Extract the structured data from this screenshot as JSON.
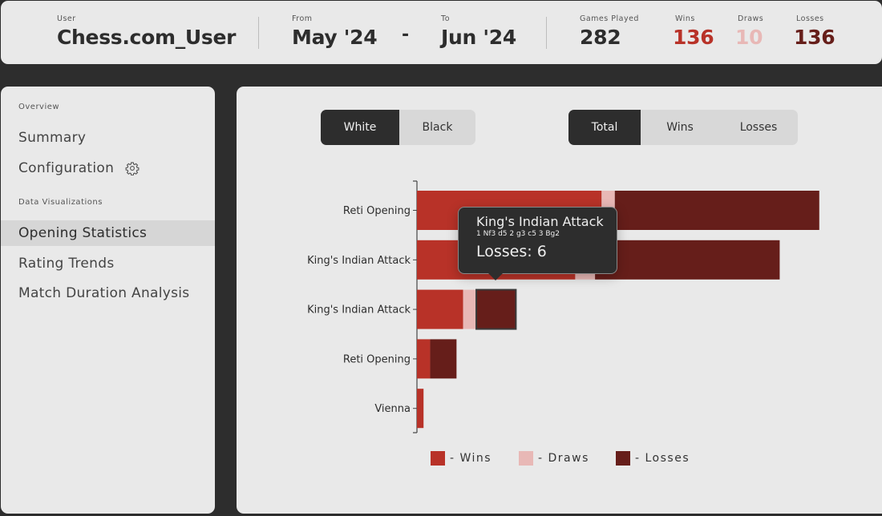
{
  "header": {
    "user_label": "User",
    "user_value": "Chess.com_User",
    "from_label": "From",
    "from_value": "May '24",
    "range_separator": "-",
    "to_label": "To",
    "to_value": "Jun '24",
    "games_label": "Games Played",
    "games_value": "282",
    "wins_label": "Wins",
    "wins_value": "136",
    "draws_label": "Draws",
    "draws_value": "10",
    "losses_label": "Losses",
    "losses_value": "136"
  },
  "colors": {
    "wins": "#b83228",
    "draws": "#e8b8b6",
    "losses": "#661e1a",
    "dark": "#2d2d2d",
    "panel": "#e9e9e9"
  },
  "sidebar": {
    "section_overview": "Overview",
    "items_overview": [
      {
        "label": "Summary"
      },
      {
        "label": "Configuration",
        "icon": "gear-icon"
      }
    ],
    "section_viz": "Data Visualizations",
    "items_viz": [
      {
        "label": "Opening Statistics",
        "active": true
      },
      {
        "label": "Rating Trends"
      },
      {
        "label": "Match Duration Analysis"
      }
    ]
  },
  "toggles": {
    "color": [
      "White",
      "Black"
    ],
    "color_selected": "White",
    "metric": [
      "Total",
      "Wins",
      "Losses"
    ],
    "metric_selected": "Total"
  },
  "tooltip": {
    "title": "King's Indian Attack",
    "moves": "1 Nf3 d5 2 g3 c5 3 Bg2",
    "value": "Losses: 6"
  },
  "chart_data": {
    "type": "bar",
    "orientation": "horizontal",
    "stacked": true,
    "categories": [
      "Reti Opening",
      "King's Indian Attack",
      "King's Indian Attack",
      "Reti Opening",
      "Vienna"
    ],
    "series": [
      {
        "name": "Wins",
        "values": [
          28,
          24,
          7,
          2,
          1
        ]
      },
      {
        "name": "Draws",
        "values": [
          2,
          3,
          2,
          0,
          0
        ]
      },
      {
        "name": "Losses",
        "values": [
          31,
          28,
          6,
          4,
          0
        ]
      }
    ],
    "xlim": [
      0,
      62
    ],
    "highlighted": {
      "category_index": 2,
      "series": "Losses"
    },
    "legend": [
      "- Wins",
      "- Draws",
      "- Losses"
    ],
    "legend_position": "bottom",
    "grid": false
  }
}
